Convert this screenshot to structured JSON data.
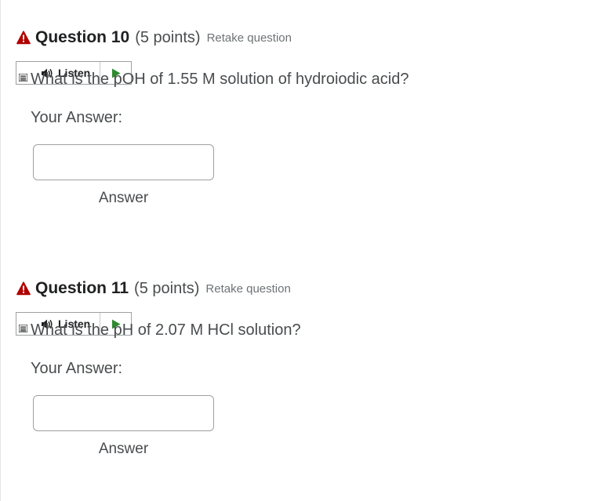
{
  "colors": {
    "warning": "#b00000",
    "play": "#2e8b2e",
    "title": "#202122",
    "body_text": "#494c4e",
    "muted_link": "#6e7376"
  },
  "questions": [
    {
      "title": "Question 10",
      "points": "(5 points)",
      "retake": "Retake question",
      "icon": "warning-triangle-icon",
      "listen_label": "Listen",
      "text": "What is the pOH of 1.55 M solution of hydroiodic acid?",
      "your_answer_label": "Your Answer:",
      "answer_value": "",
      "answer_caption": "Answer"
    },
    {
      "title": "Question 11",
      "points": "(5 points)",
      "retake": "Retake question",
      "icon": "warning-triangle-icon",
      "listen_label": "Listen",
      "text": "What is the pH of 2.07 M HCl solution?",
      "your_answer_label": "Your Answer:",
      "answer_value": "",
      "answer_caption": "Answer"
    }
  ]
}
